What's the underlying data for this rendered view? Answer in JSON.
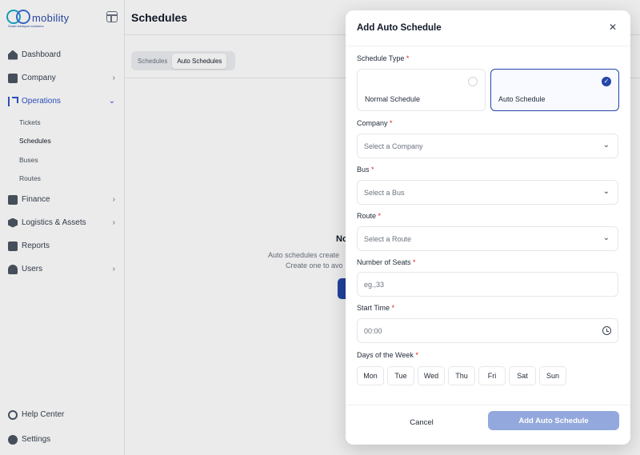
{
  "app": {
    "logo_text": "mobility",
    "logo_tagline": "Smart transport solutions"
  },
  "sidebar": {
    "items": [
      {
        "label": "Dashboard"
      },
      {
        "label": "Company"
      },
      {
        "label": "Operations"
      },
      {
        "label": "Finance"
      },
      {
        "label": "Logistics & Assets"
      },
      {
        "label": "Reports"
      },
      {
        "label": "Users"
      }
    ],
    "operations_sub": [
      {
        "label": "Tickets"
      },
      {
        "label": "Schedules"
      },
      {
        "label": "Buses"
      },
      {
        "label": "Routes"
      }
    ],
    "bottom": [
      {
        "label": "Help Center"
      },
      {
        "label": "Settings"
      }
    ]
  },
  "main": {
    "title": "Schedules",
    "tabs": [
      {
        "label": "Schedules"
      },
      {
        "label": "Auto Schedules"
      }
    ],
    "empty": {
      "title": "No",
      "desc1": "Auto schedules create",
      "desc2": "Create one to avo"
    }
  },
  "modal": {
    "title": "Add Auto Schedule",
    "schedule_type_label": "Schedule Type",
    "types": [
      {
        "label": "Normal Schedule",
        "selected": false
      },
      {
        "label": "Auto Schedule",
        "selected": true
      }
    ],
    "company_label": "Company",
    "company_placeholder": "Select a Company",
    "bus_label": "Bus",
    "bus_placeholder": "Select a Bus",
    "route_label": "Route",
    "route_placeholder": "Select a Route",
    "seats_label": "Number of Seats",
    "seats_placeholder": "eg.,33",
    "start_time_label": "Start Time",
    "start_time_value": "00:00",
    "days_label": "Days of the Week",
    "days": [
      "Mon",
      "Tue",
      "Wed",
      "Thu",
      "Fri",
      "Sat",
      "Sun"
    ],
    "cancel_label": "Cancel",
    "submit_label": "Add Auto Schedule",
    "required_mark": "*"
  },
  "colors": {
    "accent": "#2447a8",
    "submit_disabled": "#93a8dc",
    "required": "#dc2626"
  }
}
